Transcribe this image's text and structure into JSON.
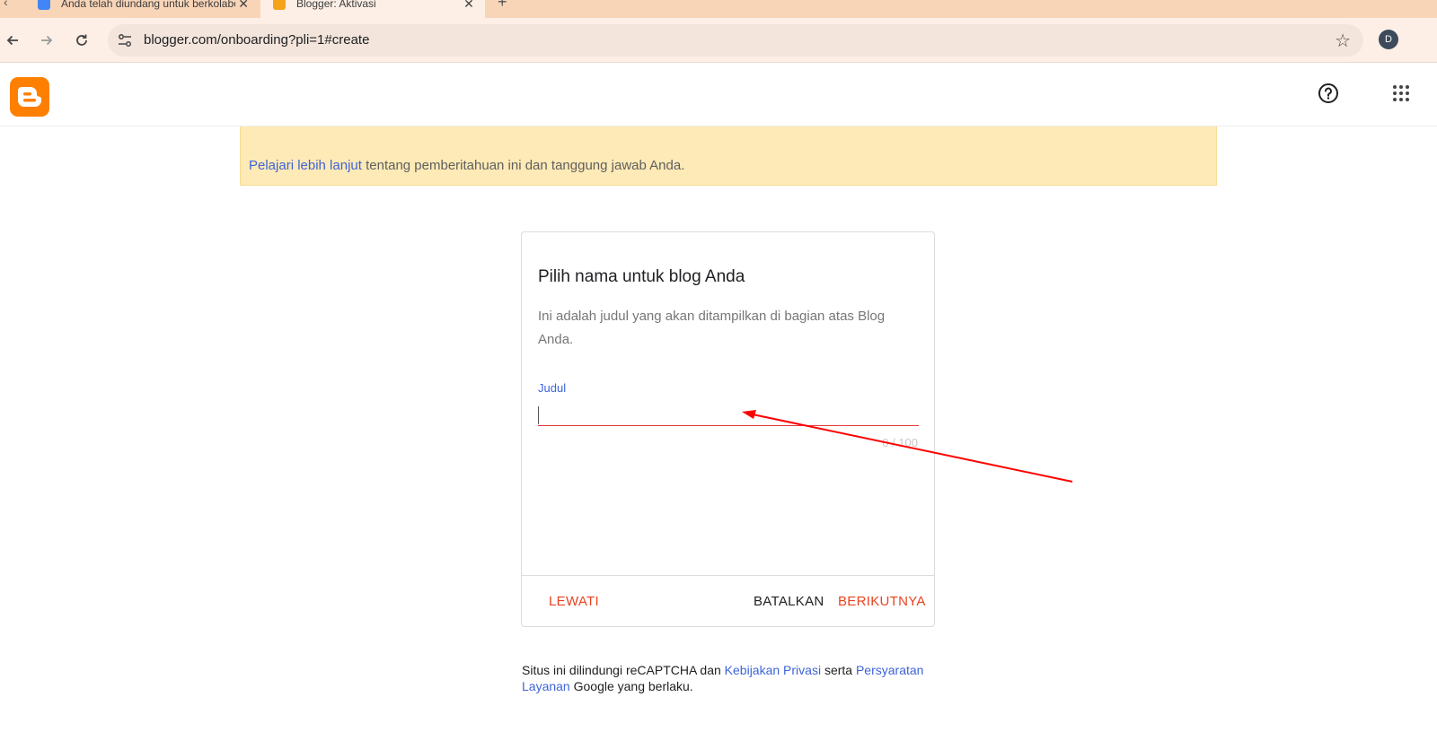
{
  "browser": {
    "tabs": [
      {
        "title": "Anda telah diundang untuk berkolaborasi",
        "favicon_color": "#4285f4",
        "active": false
      },
      {
        "title": "Blogger: Aktivasi",
        "favicon_color": "#f7a21b",
        "active": true
      }
    ],
    "new_tab_symbol": "+",
    "url": "blogger.com/onboarding?pli=1#create",
    "profile_initial": "D"
  },
  "app": {
    "logo": "blogger-logo",
    "brand_color": "#ff8000",
    "help_icon": "help-circle-icon",
    "apps_icon": "apps-grid-icon"
  },
  "notice": {
    "link_text": "Pelajari lebih lanjut",
    "text": " tentang pemberitahuan ini dan tanggung jawab Anda."
  },
  "dialog": {
    "title": "Pilih nama untuk blog Anda",
    "description": "Ini adalah judul yang akan ditampilkan di bagian atas Blog Anda.",
    "field_label": "Judul",
    "field_value": "",
    "counter": "0 / 100",
    "buttons": {
      "skip": "LEWATI",
      "cancel": "BATALKAN",
      "next": "BERIKUTNYA"
    }
  },
  "footer": {
    "part1": "Situs ini dilindungi reCAPTCHA dan ",
    "privacy_link": "Kebijakan Privasi",
    "part2": " serta ",
    "terms_link": "Persyaratan Layanan",
    "part3": " Google yang berlaku."
  },
  "annotation": {
    "arrow_color": "#ff0000"
  }
}
